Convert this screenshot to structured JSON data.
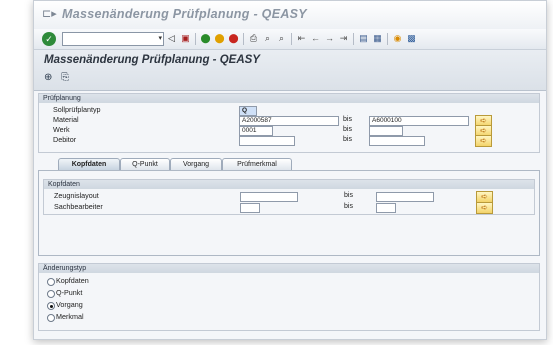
{
  "window": {
    "title": "Massenänderung Prüfplanung - QEASY"
  },
  "toolbar": {
    "icons": [
      "enter-icon",
      "back-icon",
      "save-icon",
      "green-back-icon",
      "exit-icon",
      "cancel-icon",
      "print-icon",
      "find-icon",
      "find-next-icon",
      "first-page-icon",
      "prev-page-icon",
      "next-page-icon",
      "last-page-icon",
      "new-session-icon",
      "shortcut-icon",
      "help-icon",
      "layout-icon"
    ]
  },
  "app": {
    "title": "Massenänderung Prüfplanung - QEASY",
    "icons": [
      "execute-icon",
      "get-variant-icon"
    ]
  },
  "pruefplanung": {
    "header": "Prüfplanung",
    "rows": [
      {
        "label": "Sollprüfplantyp",
        "value": "Q",
        "to_label": "",
        "to_value": ""
      },
      {
        "label": "Material",
        "value": "A2000587",
        "to_label": "bis",
        "to_value": "A6000100"
      },
      {
        "label": "Werk",
        "value": "0001",
        "to_label": "bis",
        "to_value": ""
      },
      {
        "label": "Debitor",
        "value": "",
        "to_label": "bis",
        "to_value": ""
      }
    ]
  },
  "tabs": [
    {
      "label": "Kopfdaten",
      "active": true
    },
    {
      "label": "Q-Punkt",
      "active": false
    },
    {
      "label": "Vorgang",
      "active": false
    },
    {
      "label": "Prüfmerkmal",
      "active": false
    }
  ],
  "kopfdaten": {
    "header": "Kopfdaten",
    "rows": [
      {
        "label": "Zeugnislayout",
        "value": "",
        "to_label": "bis",
        "to_value": ""
      },
      {
        "label": "Sachbearbeiter",
        "value": "",
        "to_label": "bis",
        "to_value": ""
      }
    ]
  },
  "aenderungstyp": {
    "header": "Änderungstyp",
    "options": [
      {
        "label": "Kopfdaten",
        "selected": false
      },
      {
        "label": "Q-Punkt",
        "selected": false
      },
      {
        "label": "Vorgang",
        "selected": true
      },
      {
        "label": "Merkmal",
        "selected": false
      }
    ]
  }
}
